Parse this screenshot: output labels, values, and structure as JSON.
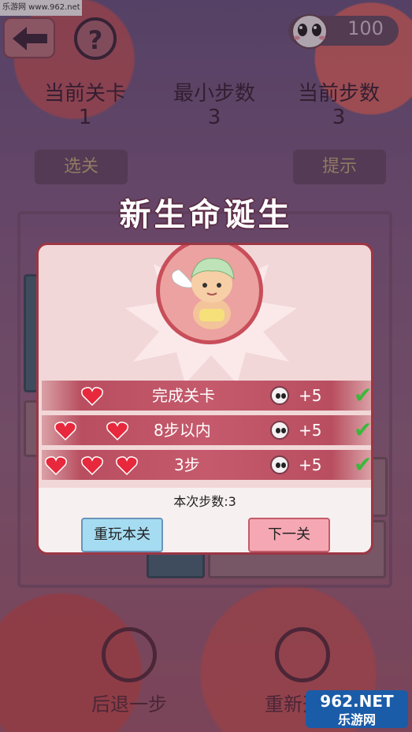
{
  "watermark_top": "乐游网 www.962.net",
  "header": {
    "help_label": "?",
    "coins": "100"
  },
  "stats": {
    "current_level_label": "当前关卡",
    "current_level_value": "1",
    "min_steps_label": "最小步数",
    "min_steps_value": "3",
    "current_steps_label": "当前步数",
    "current_steps_value": "3"
  },
  "buttons": {
    "select_level": "选关",
    "hint": "提示"
  },
  "bottom_controls": {
    "undo": "后退一步",
    "restart": "重新开始"
  },
  "watermark_bottom": {
    "line1": "962.NET",
    "line2": "乐游网"
  },
  "dialog": {
    "title": "新生命诞生",
    "rows": [
      {
        "label": "完成关卡",
        "hearts": 1,
        "reward": "+5"
      },
      {
        "label": "8步以内",
        "hearts": 2,
        "reward": "+5"
      },
      {
        "label": "3步",
        "hearts": 3,
        "reward": "+5"
      }
    ],
    "steps_text": "本次步数:3",
    "replay_button": "重玩本关",
    "next_button": "下一关"
  },
  "colors": {
    "heart": "#e8283c",
    "check": "#3cb83c",
    "dialog_border": "#9c3644",
    "row": "#c55a6c"
  }
}
